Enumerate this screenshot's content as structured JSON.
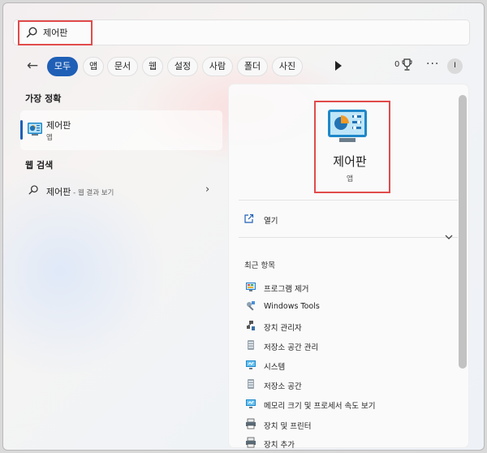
{
  "search": {
    "value": "제어판",
    "placeholder": ""
  },
  "filters": {
    "back_icon": "arrow-left-icon",
    "tabs": [
      "모두",
      "앱",
      "문서",
      "웹",
      "설정",
      "사람",
      "폴더",
      "사진"
    ],
    "active_index": 0,
    "points": "0",
    "more_label": "···",
    "avatar_initial": "I"
  },
  "best_match": {
    "title": "가장 정확",
    "name": "제어판",
    "type": "앱"
  },
  "web_search": {
    "title": "웹 검색",
    "query": "제어판",
    "sub": " - 웹 결과 보기"
  },
  "detail": {
    "name": "제어판",
    "type": "앱",
    "open_label": "열기",
    "recent_title": "최근 항목",
    "recent": [
      {
        "label": "프로그램 제거",
        "icon": "programs-icon"
      },
      {
        "label": "Windows Tools",
        "icon": "tools-icon"
      },
      {
        "label": "장치 관리자",
        "icon": "device-manager-icon"
      },
      {
        "label": "저장소 공간 관리",
        "icon": "storage-icon"
      },
      {
        "label": "시스템",
        "icon": "system-icon"
      },
      {
        "label": "저장소 공간",
        "icon": "storage-icon"
      },
      {
        "label": "메모리 크기 및 프로세서 속도 보기",
        "icon": "system-icon"
      },
      {
        "label": "장치 및 프린터",
        "icon": "printer-icon"
      },
      {
        "label": "장치 추가",
        "icon": "printer-icon"
      }
    ]
  },
  "colors": {
    "accent": "#1f5fb6",
    "highlight": "#e14b4b"
  }
}
